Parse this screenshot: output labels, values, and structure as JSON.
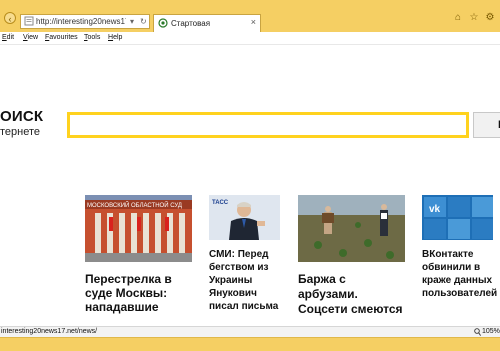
{
  "browser": {
    "address": "http://interesting20news17....",
    "tab_title": "Стартовая",
    "tab_close": "×"
  },
  "menu": {
    "edit": {
      "u": "E",
      "rest": "dit"
    },
    "view": {
      "u": "V",
      "rest": "iew"
    },
    "favourites": {
      "u": "F",
      "rest": "avourites"
    },
    "tools": {
      "u": "T",
      "rest": "ools"
    },
    "help": {
      "u": "H",
      "rest": "elp"
    }
  },
  "logo": {
    "main": "ОИСК",
    "sub": "тернете"
  },
  "search": {
    "value": "",
    "button_label": "Н"
  },
  "news": [
    {
      "title": "Перестрелка в суде Москвы: нападавшие",
      "image_text": "МОСКОВСКИЙ ОБЛАСТНОЙ СУД"
    },
    {
      "title": "СМИ: Перед бегством из Украины Янукович писал письма",
      "image_text": "ТАСС"
    },
    {
      "title": "Баржа с арбузами. Соцсети смеются",
      "image_text": ""
    },
    {
      "title": "ВКонтакте обвинили в краже данных пользователей",
      "image_text": ""
    }
  ],
  "status": {
    "url": "interesting20news17.net/news/",
    "zoom": "105%"
  },
  "colors": {
    "chrome": "#f5cf63",
    "search_border": "#ffd21e"
  }
}
